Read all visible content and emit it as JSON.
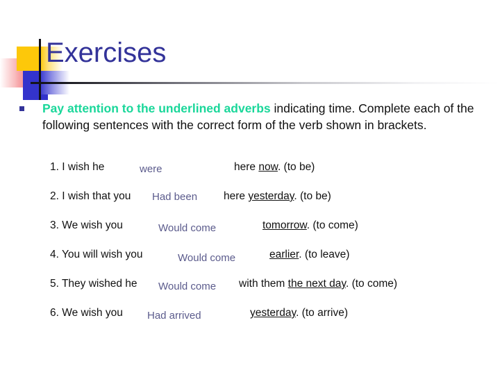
{
  "slide": {
    "title": "Exercises",
    "instruction": {
      "highlight": "Pay attention to the underlined adverbs",
      "rest": " indicating time. Complete each of the following sentences with the correct form of the verb shown in brackets."
    },
    "colors": {
      "title": "#333399",
      "highlight_green": "#1ad79a",
      "answer_blue": "#5b5b8c",
      "body_black": "#111111",
      "deco_yellow": "#fdc80a",
      "deco_blue": "#3333cc",
      "deco_red": "#ef4b55"
    },
    "exercises": [
      {
        "number": "1.",
        "prompt": "1. I wish he",
        "answer": "were",
        "tail_pre": "here ",
        "adverb": "now",
        "tail_post": ". (to be)"
      },
      {
        "number": "2.",
        "prompt": "2. I wish that you",
        "answer": "Had been",
        "tail_pre": "here ",
        "adverb": "yesterday",
        "tail_post": ". (to be)"
      },
      {
        "number": "3.",
        "prompt": "3. We wish you",
        "answer": "Would come",
        "tail_pre": "",
        "adverb": "tomorrow",
        "tail_post": ". (to come)"
      },
      {
        "number": "4.",
        "prompt": "4. You will wish you",
        "answer": "Would come",
        "tail_pre": "",
        "adverb": "earlier",
        "tail_post": ". (to leave)"
      },
      {
        "number": "5.",
        "prompt": "5. They wished he",
        "answer": "Would come",
        "tail_pre": "with them ",
        "adverb": "the next day",
        "tail_post": ". (to come)"
      },
      {
        "number": "6.",
        "prompt": "6. We wish you",
        "answer": "Had arrived",
        "tail_pre": "",
        "adverb": "yesterday",
        "tail_post": ". (to arrive)"
      }
    ]
  }
}
